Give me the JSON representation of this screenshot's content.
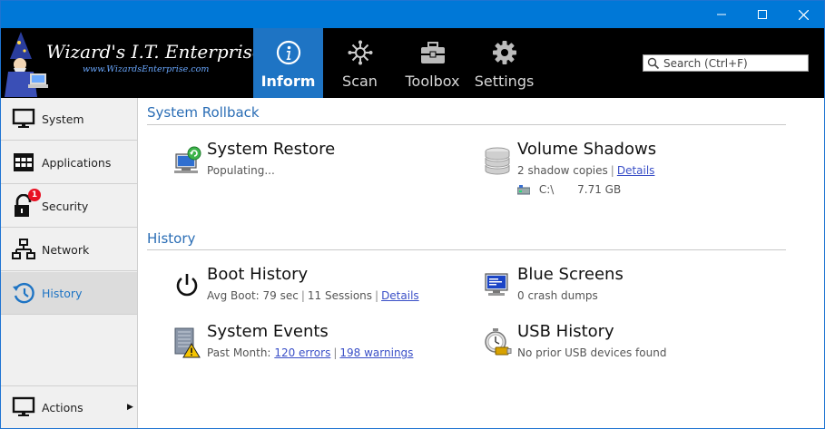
{
  "window": {
    "minimize_label": "—",
    "maximize_label": "☐",
    "close_label": "✕"
  },
  "logo": {
    "title": "Wizard's I.T. Enterprise",
    "url": "www.WizardsEnterprise.com"
  },
  "tabs": [
    {
      "label": "Inform",
      "icon": "info-icon",
      "active": true
    },
    {
      "label": "Scan",
      "icon": "virus-scan-icon",
      "active": false
    },
    {
      "label": "Toolbox",
      "icon": "toolbox-icon",
      "active": false
    },
    {
      "label": "Settings",
      "icon": "gear-icon",
      "active": false
    }
  ],
  "search": {
    "placeholder": "Search (Ctrl+F)"
  },
  "sidebar": {
    "items": [
      {
        "label": "System",
        "icon": "monitor-icon"
      },
      {
        "label": "Applications",
        "icon": "applications-icon"
      },
      {
        "label": "Security",
        "icon": "lock-icon",
        "badge": "1"
      },
      {
        "label": "Network",
        "icon": "network-icon"
      },
      {
        "label": "History",
        "icon": "history-icon",
        "active": true
      }
    ],
    "actions": {
      "label": "Actions",
      "icon": "monitor-icon",
      "arrow": "▶"
    }
  },
  "main": {
    "rollback": {
      "title": "System Rollback",
      "system_restore": {
        "title": "System Restore",
        "status": "Populating..."
      },
      "volume_shadows": {
        "title": "Volume Shadows",
        "count": "2 shadow copies",
        "sep": "|",
        "details": "Details",
        "drive": "C:\\",
        "size": "7.71 GB"
      }
    },
    "history": {
      "title": "History",
      "boot_history": {
        "title": "Boot History",
        "avg_boot": "Avg Boot: 79 sec",
        "sep1": "|",
        "sessions": "11 Sessions",
        "sep2": "|",
        "details": "Details"
      },
      "blue_screens": {
        "title": "Blue Screens",
        "status": "0 crash dumps"
      },
      "system_events": {
        "title": "System Events",
        "prefix": "Past Month:",
        "errors": "120 errors",
        "sep": "|",
        "warnings": "198 warnings"
      },
      "usb_history": {
        "title": "USB History",
        "status": "No prior USB devices found"
      }
    }
  },
  "colors": {
    "titlebar": "#0078d7",
    "header": "#000000",
    "active_tab": "#1e74c4",
    "section_title": "#2a6db5",
    "link": "#3a4fc7",
    "badge": "#e81123"
  }
}
